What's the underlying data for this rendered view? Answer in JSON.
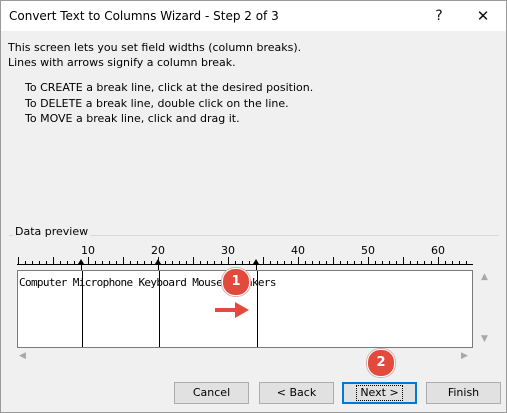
{
  "window": {
    "title": "Convert Text to Columns Wizard - Step 2 of 3",
    "help_glyph": "?",
    "close_glyph": "✕"
  },
  "intro": {
    "line1": "This screen lets you set field widths (column breaks).",
    "line2": "Lines with arrows signify a column break."
  },
  "instructions": {
    "create": "To CREATE a break line, click at the desired position.",
    "delete": "To DELETE a break line, double click on the line.",
    "move": "To MOVE a break line, click and drag it."
  },
  "preview_group": {
    "label": "Data preview"
  },
  "ruler": {
    "labels": [
      "10",
      "20",
      "30",
      "40",
      "50",
      "60"
    ]
  },
  "preview_row": "Computer Microphone Keyboard Mouse Speakers",
  "column_breaks": [
    9,
    20,
    34
  ],
  "buttons": {
    "cancel": "Cancel",
    "back": "< Back",
    "next": "Next >",
    "finish": "Finish"
  },
  "annotations": {
    "badge1": "1",
    "badge2": "2"
  },
  "colors": {
    "badge": "#e24a3e",
    "arrow": "#e24a3e",
    "default_button_border": "#0078d7"
  },
  "icons": {
    "help": "help-icon",
    "close": "close-icon",
    "arrow": "right-arrow-icon"
  }
}
